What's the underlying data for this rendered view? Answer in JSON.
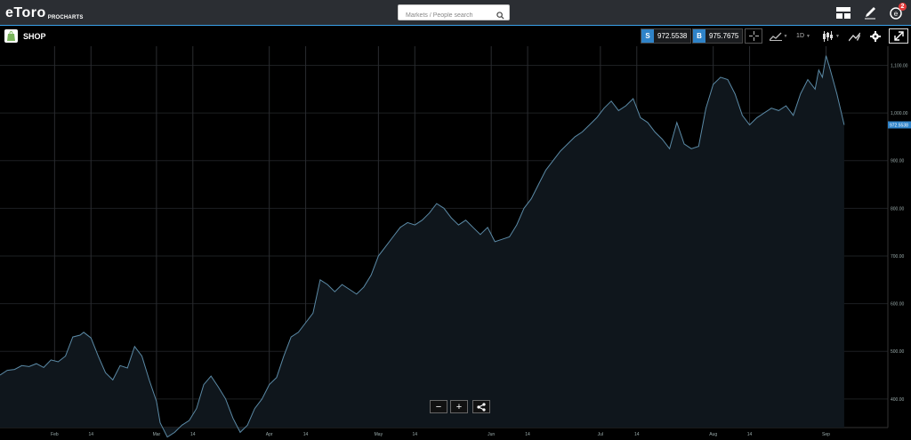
{
  "header": {
    "logo_text": "eToro",
    "logo_sub": "PROCHARTS",
    "search_placeholder": "Markets / People search",
    "notification_count": "2"
  },
  "instrument": {
    "symbol": "SHOP",
    "sell_label": "S",
    "sell_price": "972.5538",
    "buy_label": "B",
    "buy_price": "975.7675",
    "timeframe": "1D"
  },
  "colors": {
    "accent": "#3aa0e8",
    "line": "#5b8aa6",
    "area": "#0f161c",
    "grid": "#1d1f22",
    "price_label_bg": "#2f83c8"
  },
  "chart_data": {
    "type": "area",
    "title": "",
    "current_price_label": "972.5538",
    "y_ticks": [
      "1,100.00",
      "1,000.00",
      "900.00",
      "800.00",
      "700.00",
      "600.00",
      "500.00",
      "400.00"
    ],
    "y_tick_values": [
      1100,
      1000,
      900,
      800,
      700,
      600,
      500,
      400
    ],
    "ylim": [
      340,
      1140
    ],
    "x_ticks": [
      {
        "label": "Feb",
        "x": 23
      },
      {
        "label": "14",
        "x": 33
      },
      {
        "label": "Mar",
        "x": 51
      },
      {
        "label": "14",
        "x": 61
      },
      {
        "label": "Apr",
        "x": 82
      },
      {
        "label": "14",
        "x": 92
      },
      {
        "label": "May",
        "x": 112
      },
      {
        "label": "14",
        "x": 122
      },
      {
        "label": "Jun",
        "x": 143
      },
      {
        "label": "14",
        "x": 153
      },
      {
        "label": "Jul",
        "x": 173
      },
      {
        "label": "14",
        "x": 183
      },
      {
        "label": "Aug",
        "x": 204
      },
      {
        "label": "14",
        "x": 214
      },
      {
        "label": "Sep",
        "x": 235
      }
    ],
    "xlim": [
      8,
      252
    ],
    "x": [
      8,
      10,
      12,
      14,
      16,
      18,
      20,
      22,
      24,
      26,
      28,
      30,
      31,
      33,
      35,
      37,
      39,
      41,
      43,
      45,
      47,
      49,
      51,
      52,
      54,
      56,
      58,
      60,
      62,
      64,
      66,
      68,
      70,
      72,
      74,
      76,
      78,
      80,
      82,
      84,
      86,
      88,
      90,
      92,
      94,
      96,
      98,
      100,
      102,
      104,
      106,
      108,
      110,
      112,
      114,
      116,
      118,
      120,
      122,
      124,
      126,
      128,
      130,
      132,
      134,
      136,
      138,
      140,
      142,
      144,
      146,
      148,
      150,
      152,
      154,
      156,
      158,
      160,
      162,
      164,
      166,
      168,
      170,
      172,
      174,
      176,
      178,
      180,
      182,
      184,
      186,
      188,
      190,
      192,
      194,
      196,
      198,
      200,
      202,
      204,
      206,
      208,
      210,
      212,
      214,
      216,
      218,
      220,
      222,
      224,
      226,
      228,
      230,
      232,
      233,
      234,
      235,
      236,
      238,
      240
    ],
    "values": [
      450,
      460,
      462,
      470,
      468,
      474,
      466,
      482,
      478,
      490,
      530,
      534,
      540,
      528,
      490,
      455,
      440,
      470,
      465,
      510,
      490,
      440,
      395,
      350,
      320,
      330,
      345,
      355,
      380,
      430,
      448,
      425,
      400,
      360,
      330,
      345,
      380,
      400,
      430,
      445,
      490,
      530,
      540,
      560,
      580,
      650,
      640,
      625,
      640,
      630,
      620,
      635,
      660,
      700,
      720,
      740,
      760,
      770,
      765,
      775,
      790,
      810,
      800,
      780,
      765,
      775,
      760,
      745,
      760,
      730,
      735,
      740,
      765,
      800,
      820,
      850,
      880,
      900,
      920,
      935,
      950,
      960,
      975,
      990,
      1010,
      1025,
      1005,
      1015,
      1030,
      990,
      980,
      960,
      945,
      925,
      980,
      935,
      925,
      930,
      1010,
      1060,
      1075,
      1070,
      1040,
      995,
      975,
      990,
      1000,
      1010,
      1005,
      1015,
      995,
      1040,
      1070,
      1050,
      1090,
      1075,
      1120,
      1095,
      1040,
      975
    ]
  }
}
